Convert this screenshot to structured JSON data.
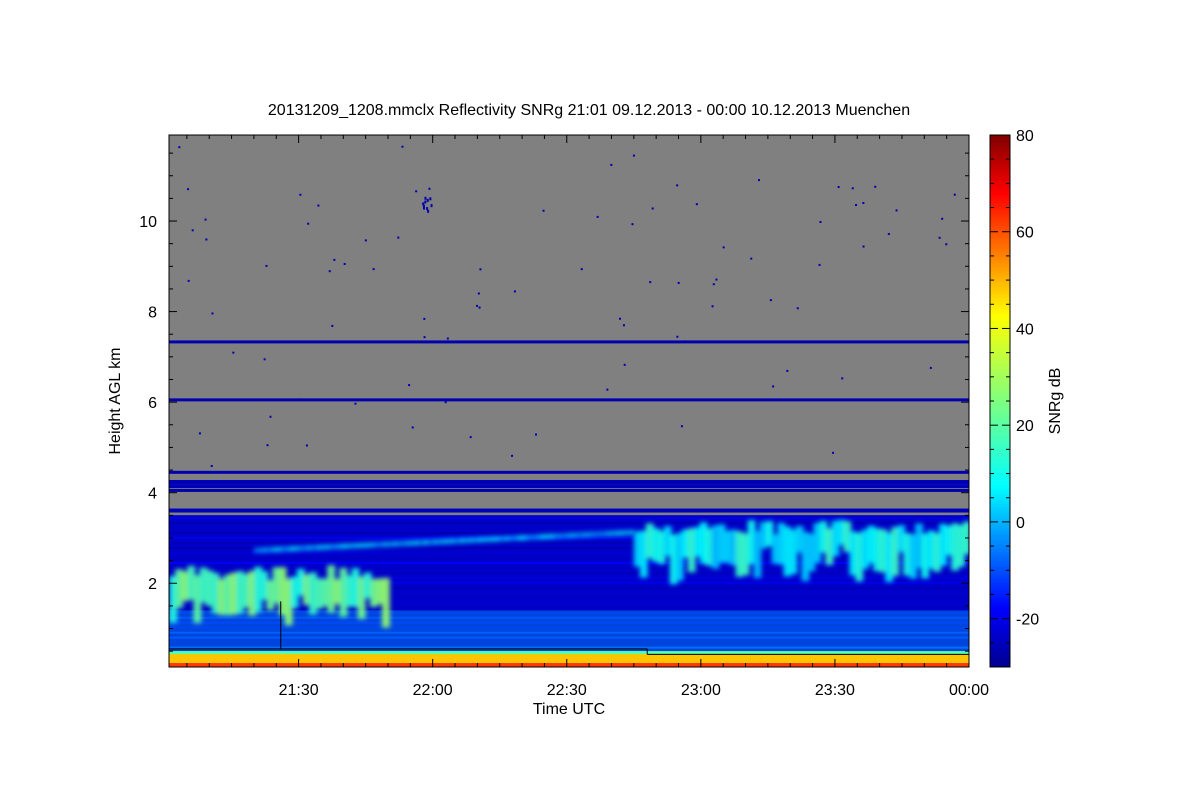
{
  "chart_data": {
    "type": "heatmap",
    "title": "20131209_1208.mmclx Reflectivity SNRg   21:01 09.12.2013 - 00:00 10.12.2013 Muenchen",
    "xlabel": "Time UTC",
    "ylabel": "Height AGL km",
    "colorbar_label": "SNRg dB",
    "x_range": [
      "21:01",
      "00:00"
    ],
    "xlim_minutes": [
      1261,
      1440
    ],
    "ylim": [
      0.15,
      11.9
    ],
    "x_ticks": [
      {
        "minute": 1290,
        "label": "21:30"
      },
      {
        "minute": 1320,
        "label": "22:00"
      },
      {
        "minute": 1350,
        "label": "22:30"
      },
      {
        "minute": 1380,
        "label": "23:00"
      },
      {
        "minute": 1410,
        "label": "23:30"
      },
      {
        "minute": 1440,
        "label": "00:00"
      }
    ],
    "y_ticks": [
      2,
      4,
      6,
      8,
      10
    ],
    "colorbar_range": [
      -30,
      80
    ],
    "colorbar_ticks": [
      -20,
      0,
      20,
      40,
      60,
      80
    ],
    "colormap": "jet",
    "background_color": "#808080",
    "features": [
      {
        "name": "surface layer",
        "y_range": [
          0.15,
          0.5
        ],
        "snr_db": 45
      },
      {
        "name": "low cloud / boundary layer",
        "y_range": [
          0.5,
          1.4
        ],
        "snr_db": 5
      },
      {
        "name": "precipitation layer 21:01-21:50",
        "x_range": [
          "21:01",
          "21:50"
        ],
        "y_range": [
          1.3,
          2.4
        ],
        "snr_db": 20
      },
      {
        "name": "cloud layer 22:45-00:00",
        "x_range": [
          "22:45",
          "00:00"
        ],
        "y_range": [
          2.3,
          3.4
        ],
        "snr_db": 10
      },
      {
        "name": "noise band",
        "y": 7.33,
        "snr_db": -25
      },
      {
        "name": "noise band",
        "y": 6.05,
        "snr_db": -25
      },
      {
        "name": "noise band",
        "y": 4.45,
        "snr_db": -25
      },
      {
        "name": "noise band",
        "y": 4.05,
        "snr_db": -25
      }
    ]
  }
}
